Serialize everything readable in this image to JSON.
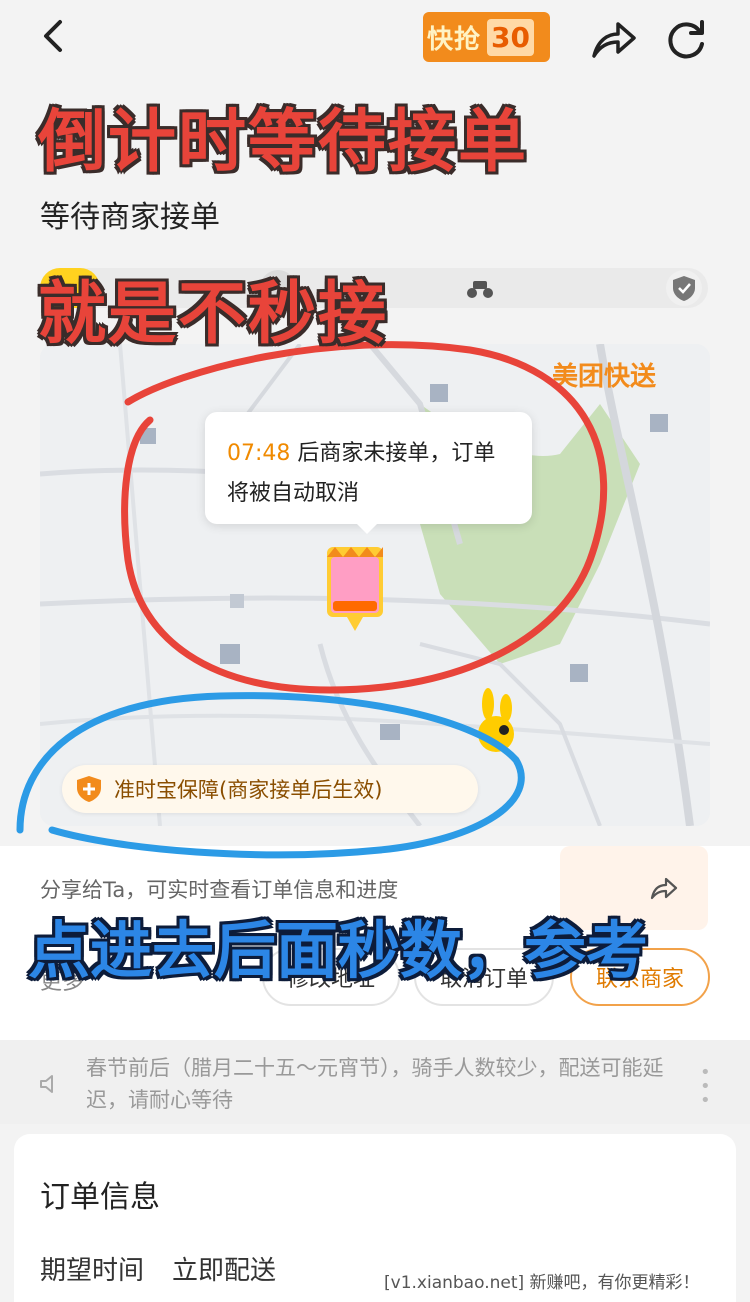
{
  "header": {
    "promo_text": "快抢",
    "promo_count": "30"
  },
  "annotations": {
    "line1": "倒计时等待接单",
    "line2": "就是不秒接",
    "line3": "点进去后面秒数，参考"
  },
  "order_status": "等待商家接单",
  "map": {
    "countdown_time": "07:48",
    "countdown_msg": "后商家未接单，订单将被自动取消",
    "brand_logo": "美团快送",
    "guarantee": "准时宝保障(商家接单后生效)"
  },
  "share": {
    "text": "分享给Ta，可实时查看订单信息和进度"
  },
  "actions": {
    "more": "更多",
    "modify_address": "修改地址",
    "cancel_order": "取消订单",
    "contact_merchant": "联系商家"
  },
  "notice": {
    "text": "春节前后（腊月二十五～元宵节），骑手人数较少，配送可能延迟，请耐心等待"
  },
  "order_info": {
    "title": "订单信息",
    "expected_time_label": "期望时间",
    "expected_time_value": "立即配送"
  },
  "watermark": "[v1.xianbao.net] 新赚吧，有你更精彩！",
  "colors": {
    "brand_orange": "#f28b1c",
    "annotation_red": "#e8443a",
    "annotation_blue": "#2c86e6",
    "progress_yellow": "#ffd21f"
  }
}
